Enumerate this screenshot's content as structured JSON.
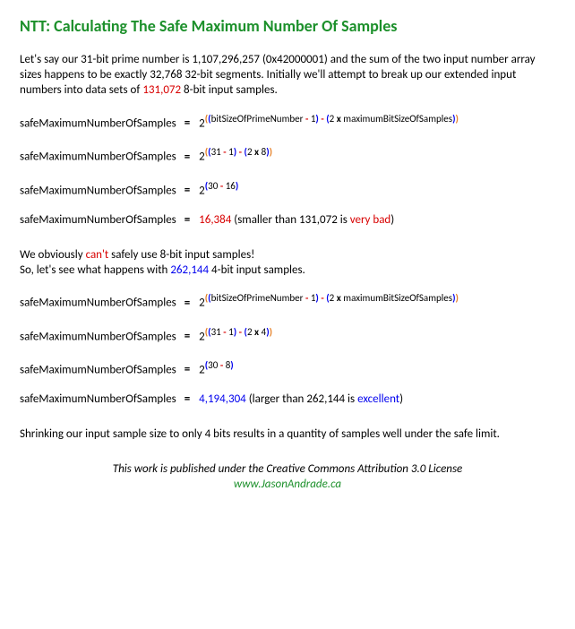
{
  "title": "NTT: Calculating The Safe Maximum Number Of Samples",
  "para1_a": "Let's say our 31-bit prime number is 1,107,296,257 (0x42000001) and the sum of the two input number array sizes happens to be exactly 32,768 32-bit segments.  Initially we'll attempt to break up our extended input numbers into data sets of ",
  "para1_b": "131,072",
  "para1_c": " 8-bit input samples.",
  "lhs": "safeMaximumNumberOfSamples",
  "eqsym": "=",
  "base": "2",
  "f_bits": "bitSizeOfPrimeNumber",
  "f_max": "maximumBitSizeOfSamples",
  "minus1": "1",
  "mul2": "2",
  "x": "x",
  "n31": "31",
  "n8": "8",
  "n30": "30",
  "n16": "16",
  "n4": "4",
  "n262": "262,144",
  "res1": "16,384",
  "res1_tail_a": "  (smaller than 131,072 is ",
  "res1_tail_b": "very bad",
  "res1_tail_c": ")",
  "para2_a": "We obviously ",
  "para2_b": "can't",
  "para2_c": " safely use 8-bit input samples!",
  "para2_d": "So, let's see what happens with ",
  "para2_e": "262,144",
  "para2_f": " 4-bit input samples.",
  "n4b": "4",
  "n8b": "8",
  "res2": "4,194,304",
  "res2_tail_a": "  (larger than 262,144 is ",
  "res2_tail_b": "excellent",
  "res2_tail_c": ")",
  "para3": "Shrinking our input sample size to only 4 bits results in a quantity of samples well under the safe limit.",
  "footer1": "This work is published under the Creative Commons Attribution 3.0 License",
  "footer2": "www.JasonAndrade.ca"
}
